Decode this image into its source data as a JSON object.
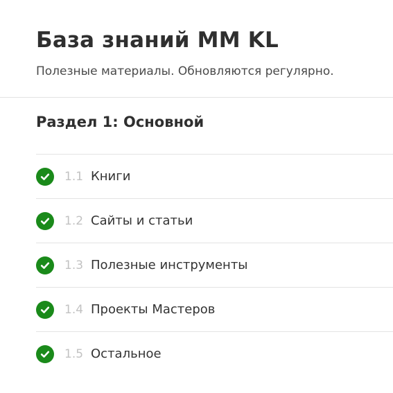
{
  "header": {
    "title": "База знаний ММ KL",
    "subtitle": "Полезные материалы. Обновляются регулярно."
  },
  "section": {
    "title": "Раздел 1: Основной",
    "lessons": [
      {
        "number": "1.1",
        "label": "Книги",
        "status": "completed",
        "icon": "check-circle-icon"
      },
      {
        "number": "1.2",
        "label": "Сайты и статьи",
        "status": "completed",
        "icon": "check-circle-icon"
      },
      {
        "number": "1.3",
        "label": "Полезные инструменты",
        "status": "completed",
        "icon": "check-circle-icon"
      },
      {
        "number": "1.4",
        "label": "Проекты Мастеров",
        "status": "completed",
        "icon": "check-circle-icon"
      },
      {
        "number": "1.5",
        "label": "Остальное",
        "status": "completed",
        "icon": "check-circle-icon"
      }
    ]
  },
  "colors": {
    "accent_completed": "#1a8a1a",
    "text_primary": "#333333",
    "text_muted": "#c2c2c2",
    "divider": "#e3e3e3"
  }
}
